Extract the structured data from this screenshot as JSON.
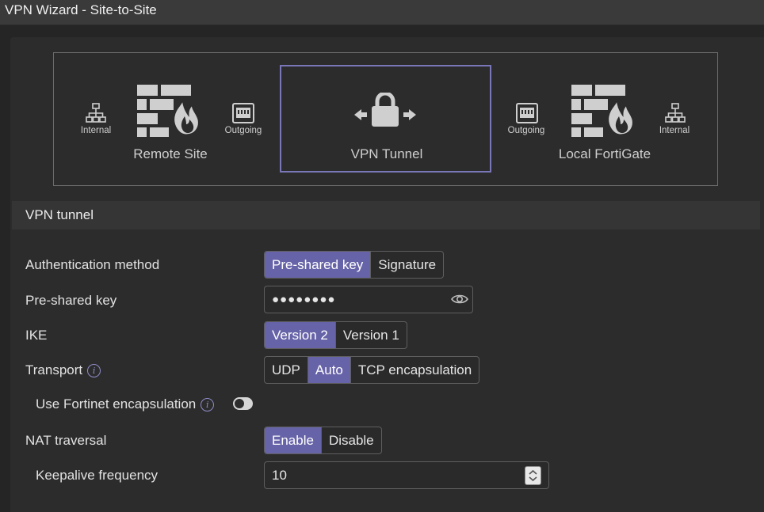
{
  "window": {
    "title": "VPN Wizard - Site-to-Site"
  },
  "topology": {
    "remote": {
      "internal_label": "Internal",
      "site_label": "Remote Site",
      "outgoing_label": "Outgoing"
    },
    "tunnel": {
      "label": "VPN Tunnel"
    },
    "local": {
      "outgoing_label": "Outgoing",
      "site_label": "Local FortiGate",
      "internal_label": "Internal"
    }
  },
  "section": {
    "title": "VPN tunnel"
  },
  "form": {
    "auth_method": {
      "label": "Authentication method",
      "options": [
        "Pre-shared key",
        "Signature"
      ],
      "selected": "Pre-shared key"
    },
    "psk": {
      "label": "Pre-shared key",
      "value": "●●●●●●●●"
    },
    "ike": {
      "label": "IKE",
      "options": [
        "Version 2",
        "Version 1"
      ],
      "selected": "Version 2"
    },
    "transport": {
      "label": "Transport",
      "options": [
        "UDP",
        "Auto",
        "TCP encapsulation"
      ],
      "selected": "Auto"
    },
    "fortinet_encap": {
      "label": "Use Fortinet encapsulation",
      "enabled": false
    },
    "nat_traversal": {
      "label": "NAT traversal",
      "options": [
        "Enable",
        "Disable"
      ],
      "selected": "Enable"
    },
    "keepalive": {
      "label": "Keepalive frequency",
      "value": "10"
    }
  },
  "colors": {
    "accent": "#6763a8",
    "tunnel_border": "#7a77b8",
    "background": "#252525"
  },
  "icons": [
    "network-icon",
    "firewall-icon",
    "interface-port-icon",
    "lock-arrows-icon",
    "info-icon",
    "eye-icon",
    "stepper-icon"
  ]
}
